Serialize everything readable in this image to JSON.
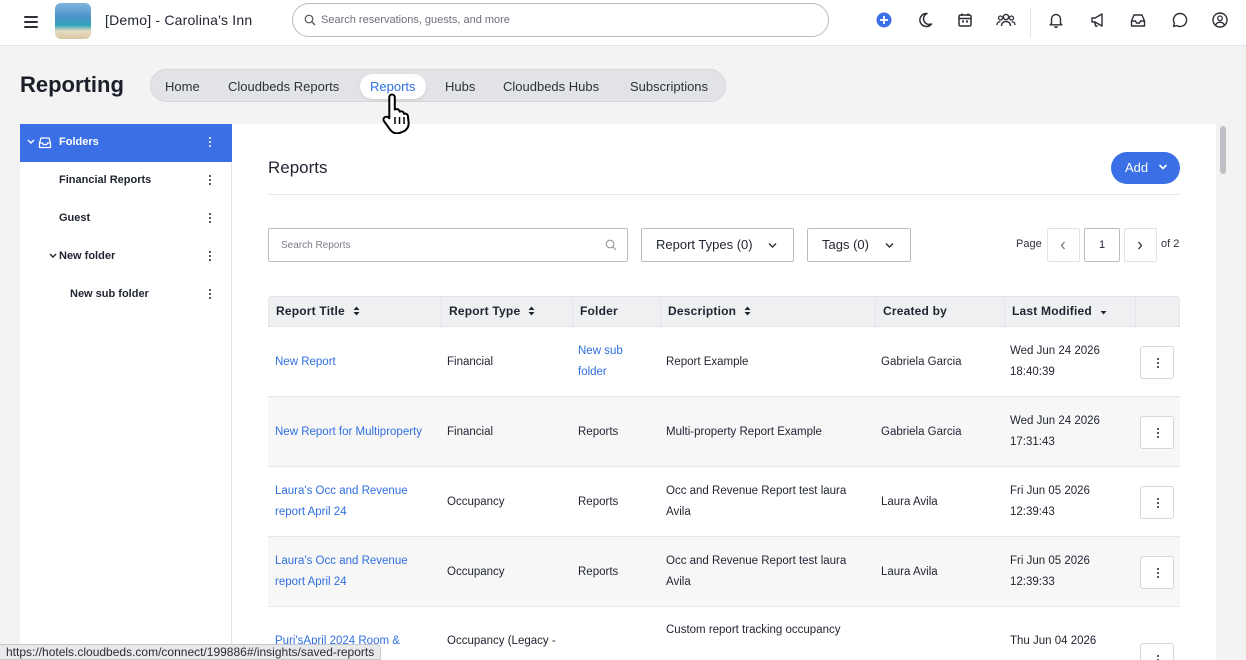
{
  "header": {
    "hotel_name": "[Demo] - Carolina's Inn",
    "search_placeholder": "Search reservations, guests, and more",
    "icons": [
      "menu-icon",
      "plus-circle-icon",
      "moon-icon",
      "calendar-icon",
      "users-icon",
      "bell-icon",
      "megaphone-icon",
      "inbox-icon",
      "chat-icon",
      "user-circle-icon"
    ],
    "accent_color": "#3b6fe6"
  },
  "page": {
    "title": "Reporting",
    "tabs": [
      {
        "label": "Home",
        "active": false
      },
      {
        "label": "Cloudbeds Reports",
        "active": false
      },
      {
        "label": "Reports",
        "active": true
      },
      {
        "label": "Hubs",
        "active": false
      },
      {
        "label": "Cloudbeds Hubs",
        "active": false
      },
      {
        "label": "Subscriptions",
        "active": false
      }
    ]
  },
  "sidebar": {
    "items": [
      {
        "label": "Folders",
        "selected": true,
        "expanded": true
      },
      {
        "label": "Financial Reports",
        "selected": false
      },
      {
        "label": "Guest",
        "selected": false
      },
      {
        "label": "New folder",
        "selected": false,
        "expanded": true
      },
      {
        "label": "New sub folder",
        "selected": false
      }
    ]
  },
  "reports": {
    "title": "Reports",
    "add_label": "Add",
    "search_placeholder": "Search Reports",
    "report_types_label": "Report Types (0)",
    "tags_label": "Tags (0)",
    "page_label": "Page",
    "current_page": "1",
    "of_label": "of 2",
    "columns": [
      "Report Title",
      "Report Type",
      "Folder",
      "Description",
      "Created by",
      "Last Modified"
    ],
    "rows": [
      {
        "title": "New Report",
        "type": "Financial",
        "folder": "New sub folder",
        "folder_link": true,
        "description": "Report Example",
        "created_by": "Gabriela Garcia",
        "modified": "Wed Jun 24 2026 18:40:39"
      },
      {
        "title": "New Report for Multiproperty",
        "type": "Financial",
        "folder": "Reports",
        "folder_link": false,
        "description": "Multi-property Report Example",
        "created_by": "Gabriela Garcia",
        "modified": "Wed Jun 24 2026 17:31:43"
      },
      {
        "title": "Laura's Occ and Revenue report April 24",
        "type": "Occupancy",
        "folder": "Reports",
        "folder_link": false,
        "description": "Occ and Revenue Report test laura Avila",
        "created_by": "Laura Avila",
        "modified": "Fri Jun 05 2026 12:39:43"
      },
      {
        "title": "Laura's Occ and Revenue report April 24",
        "type": "Occupancy",
        "folder": "Reports",
        "folder_link": false,
        "description": "Occ and Revenue Report test laura Avila",
        "created_by": "Laura Avila",
        "modified": "Fri Jun 05 2026 12:39:33"
      },
      {
        "title": "Puri'sApril 2024 Room &",
        "type": "Occupancy (Legacy -",
        "folder": "",
        "folder_link": false,
        "description": "Custom report tracking occupancy",
        "created_by": "",
        "modified": "Thu Jun 04 2026"
      }
    ]
  },
  "status_bar": {
    "url": "https://hotels.cloudbeds.com/connect/199886#/insights/saved-reports"
  }
}
